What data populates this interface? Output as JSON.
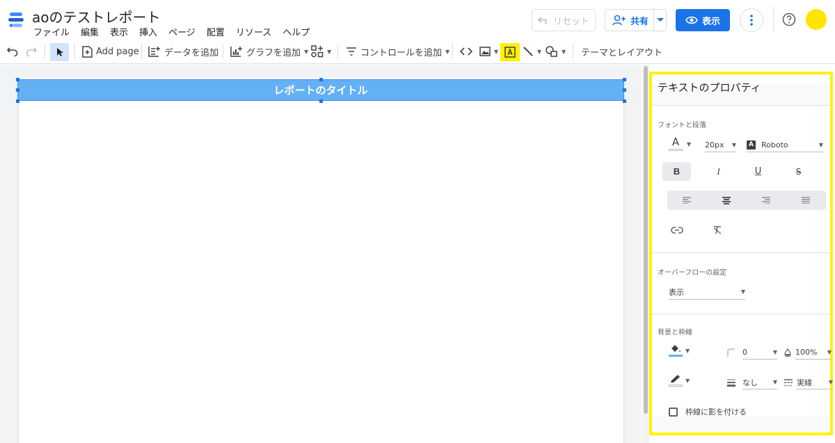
{
  "header": {
    "title": "aoのテストレポート",
    "menu": [
      "ファイル",
      "編集",
      "表示",
      "挿入",
      "ページ",
      "配置",
      "リソース",
      "ヘルプ"
    ],
    "reset_label": "リセット",
    "share_label": "共有",
    "view_label": "表示",
    "icons": [
      "looker-studio-logo",
      "undo-icon",
      "person-add-icon",
      "eye-icon",
      "more-vert-icon",
      "help-icon",
      "avatar"
    ]
  },
  "toolbar": {
    "add_page": "Add page",
    "add_data": "データを追加",
    "add_chart": "グラフを追加",
    "add_control": "コントロールを追加",
    "theme_layout": "テーマとレイアウト"
  },
  "canvas": {
    "title_text": "レポートのタイトル"
  },
  "panel": {
    "title": "テキストのプロパティ",
    "font_section": "フォントと段落",
    "font_size": "20px",
    "font_family": "Roboto",
    "font_family_badge": "A",
    "overflow_section": "オーバーフローの設定",
    "overflow_value": "表示",
    "bg_section": "背景と枠線",
    "corner_radius": "0",
    "opacity": "100%",
    "border_weight": "なし",
    "border_style": "実線",
    "shadow_label": "枠線に影を付ける",
    "format_labels": {
      "bold": "B",
      "italic": "I",
      "underline": "U",
      "strike": "S",
      "font_color": "A"
    }
  },
  "colors": {
    "accent": "#1a73e8",
    "highlight": "#fff100",
    "title_box": "#64b0f5",
    "avatar": "#ffe600"
  }
}
